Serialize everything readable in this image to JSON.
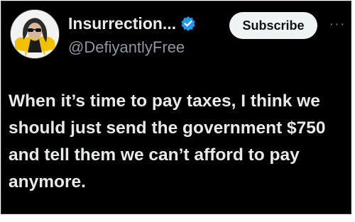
{
  "post": {
    "display_name": "Insurrection...",
    "handle": "@DefiyantlyFree",
    "subscribe_label": "Subscribe",
    "more_label": "···",
    "text": "When it’s time to pay taxes, I think we should just send the government $750 and tell them we can’t afford to pay anymore.",
    "verified": true,
    "icons": {
      "avatar": "avatar-image",
      "verified": "verified-badge-icon",
      "more": "more-options-icon"
    }
  },
  "colors": {
    "background": "#000000",
    "text_primary": "#e7e9ea",
    "text_secondary": "#8b98a5",
    "verified_blue": "#1d9bf0",
    "button_bg": "#eff3f4"
  }
}
